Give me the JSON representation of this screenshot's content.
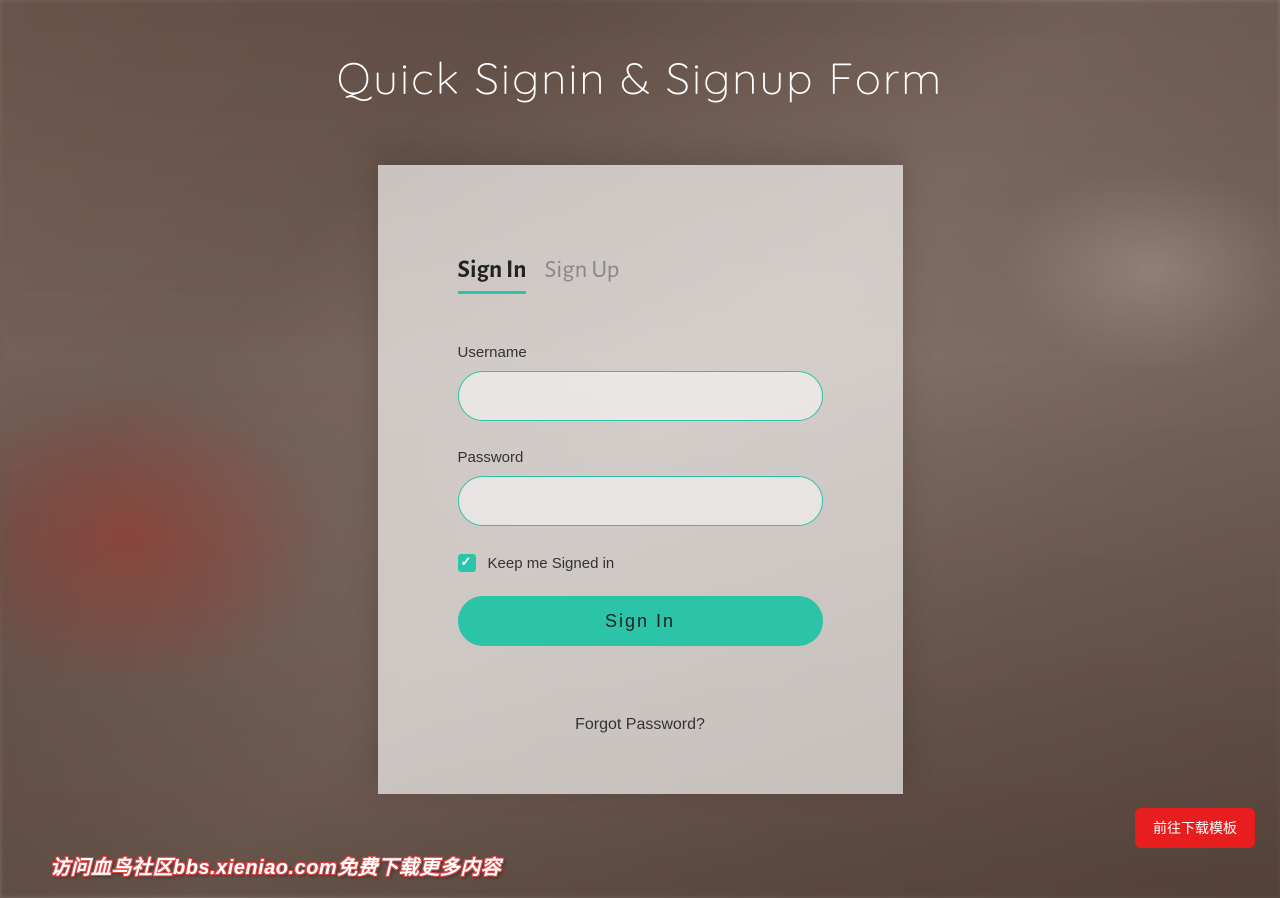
{
  "page": {
    "title": "Quick Signin & Signup Form"
  },
  "tabs": {
    "signin": "Sign In",
    "signup": "Sign Up"
  },
  "form": {
    "username_label": "Username",
    "username_value": "",
    "password_label": "Password",
    "password_value": "",
    "keep_signed_label": "Keep me Signed in",
    "keep_signed_checked": true,
    "submit_label": "Sign In",
    "forgot_label": "Forgot Password?"
  },
  "floating": {
    "download_label": "前往下载模板",
    "watermark_text": "访问血鸟社区bbs.xieniao.com免费下载更多内容"
  },
  "colors": {
    "accent": "#2cc4a9",
    "danger": "#e81e1e"
  }
}
